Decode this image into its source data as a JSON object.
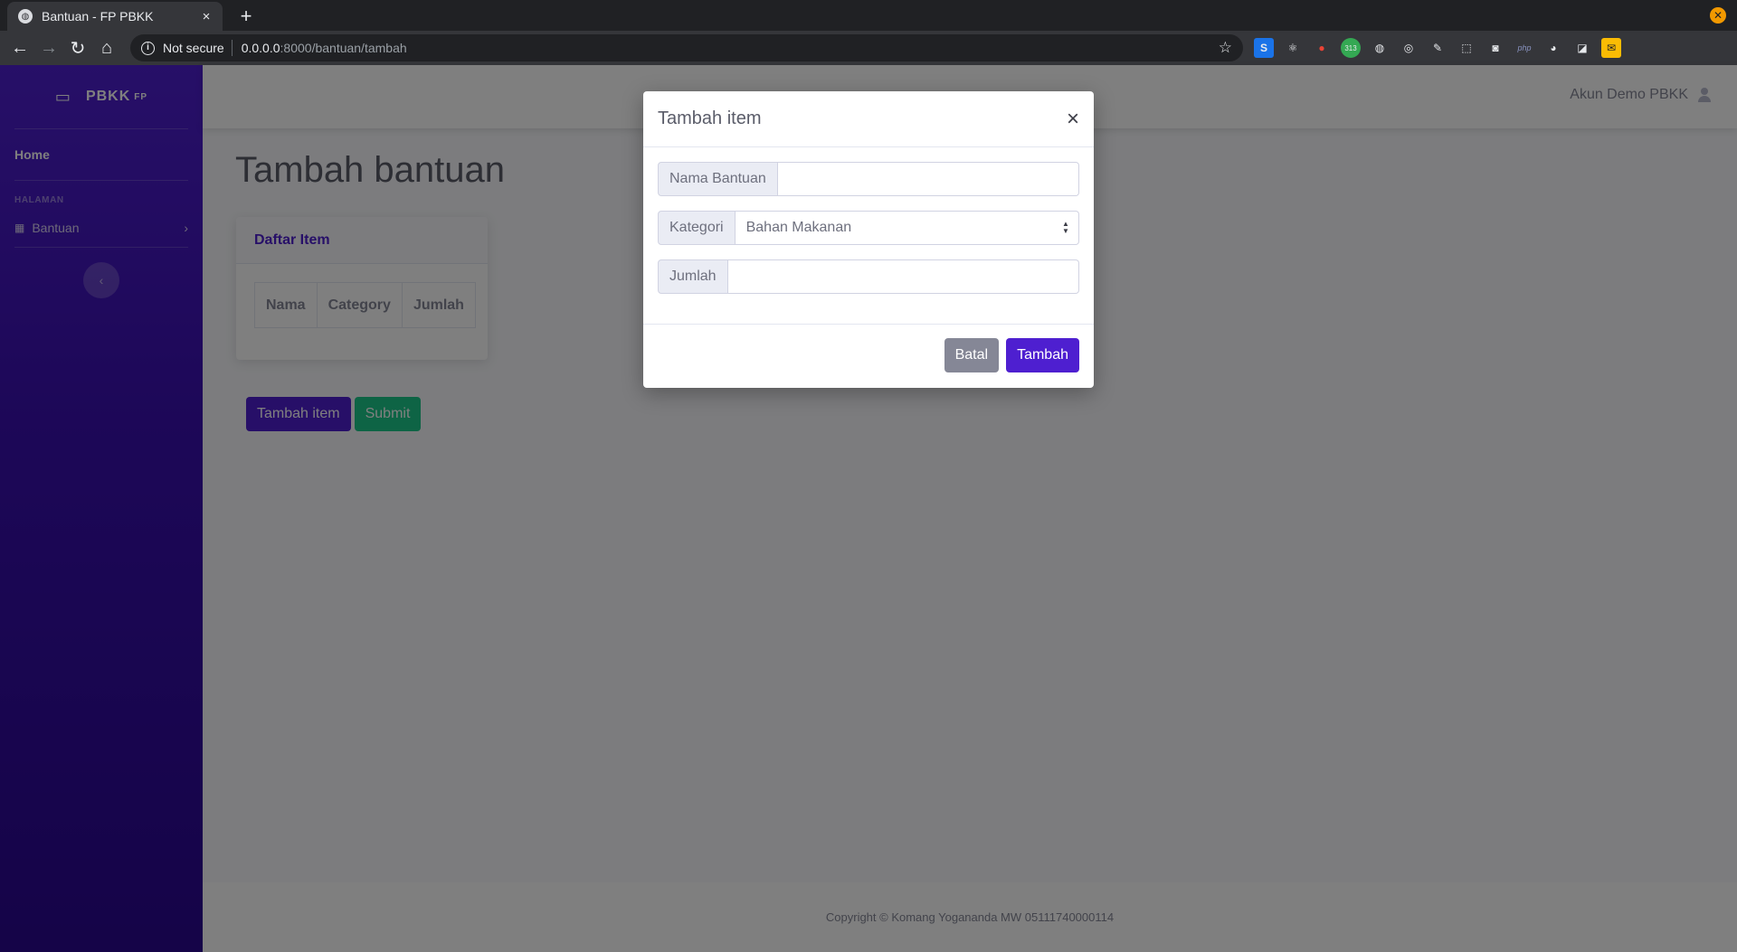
{
  "browser": {
    "tab_title": "Bantuan - FP PBKK",
    "tab_close": "×",
    "new_tab": "+",
    "security_label": "Not secure",
    "url_host": "0.0.0.0",
    "url_path": ":8000/bantuan/tambah",
    "extensions": [
      "S",
      "⚛",
      "●",
      "313",
      "◍",
      "◎",
      "✎",
      "⬚",
      "◙",
      "php",
      "◕",
      "◪",
      "✉"
    ]
  },
  "sidebar": {
    "brand": "PBKK",
    "brand_sup": "FP",
    "home_label": "Home",
    "heading": "HALAMAN",
    "items": [
      {
        "label": "Bantuan"
      }
    ]
  },
  "topbar": {
    "user_name": "Akun Demo PBKK"
  },
  "main": {
    "page_title": "Tambah bantuan",
    "card_title": "Daftar Item",
    "table_headers": [
      "Nama",
      "Category",
      "Jumlah"
    ],
    "add_item_button": "Tambah item",
    "submit_button": "Submit"
  },
  "footer": {
    "copyright": "Copyright © Komang Yogananda MW 05111740000114"
  },
  "modal": {
    "title": "Tambah item",
    "close": "×",
    "fields": {
      "nama_label": "Nama Bantuan",
      "nama_value": "",
      "kategori_label": "Kategori",
      "kategori_value": "Bahan Makanan",
      "jumlah_label": "Jumlah",
      "jumlah_value": ""
    },
    "cancel_button": "Batal",
    "confirm_button": "Tambah"
  },
  "colors": {
    "primary": "#4e1fd0",
    "success": "#1cc88a",
    "secondary": "#858796"
  }
}
